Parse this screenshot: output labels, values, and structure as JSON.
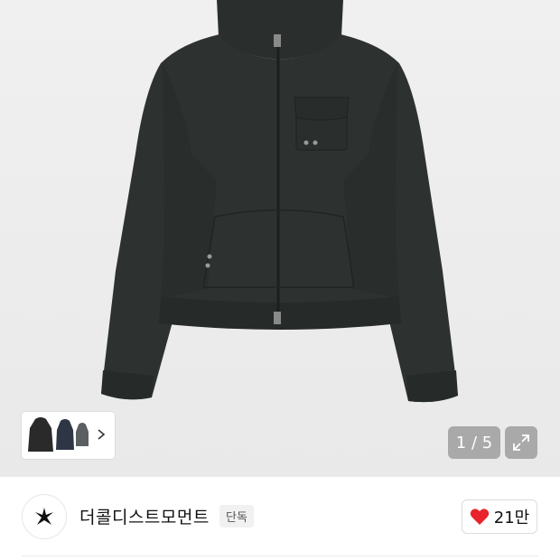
{
  "gallery": {
    "counter": "1 / 5",
    "thumbnails": [
      "black-hoodie",
      "navy-hoodie",
      "grey-hoodie"
    ]
  },
  "brand": {
    "name": "더콜디스트모먼트",
    "badge": "단독"
  },
  "like": {
    "count": "21만",
    "color": "#e8232b"
  },
  "colors": {
    "hero_bg": "#ececec",
    "garment": "#2b302f",
    "overlay_button": "#a9a9a9"
  }
}
